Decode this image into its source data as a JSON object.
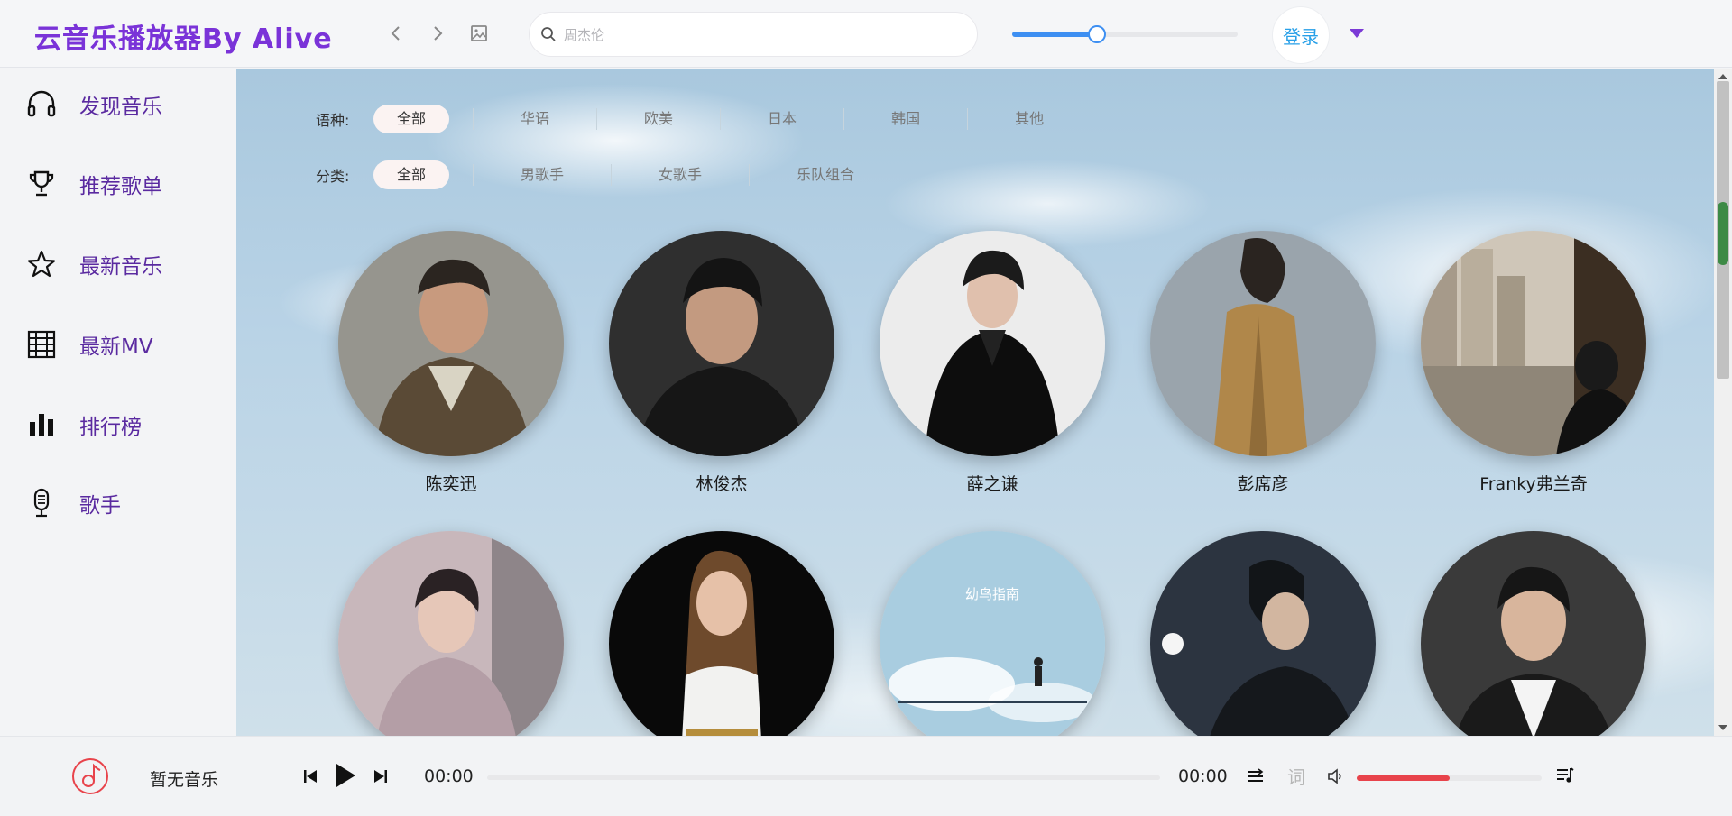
{
  "app": {
    "title": "云音乐播放器By Alive"
  },
  "header": {
    "search": {
      "placeholder": "周杰伦",
      "value": ""
    },
    "volume_level": 0.37,
    "login_label": "登录"
  },
  "sidebar": {
    "items": [
      {
        "label": "发现音乐",
        "icon": "headphones-icon"
      },
      {
        "label": "推荐歌单",
        "icon": "trophy-icon"
      },
      {
        "label": "最新音乐",
        "icon": "star-icon"
      },
      {
        "label": "最新MV",
        "icon": "film-icon"
      },
      {
        "label": "排行榜",
        "icon": "bar-chart-icon"
      },
      {
        "label": "歌手",
        "icon": "microphone-icon"
      }
    ]
  },
  "filters": {
    "language": {
      "label": "语种:",
      "options": [
        "全部",
        "华语",
        "欧美",
        "日本",
        "韩国",
        "其他"
      ],
      "selected": "全部"
    },
    "category": {
      "label": "分类:",
      "options": [
        "全部",
        "男歌手",
        "女歌手",
        "乐队组合"
      ],
      "selected": "全部"
    }
  },
  "artists": [
    {
      "name": "陈奕迅"
    },
    {
      "name": "林俊杰"
    },
    {
      "name": "薛之谦"
    },
    {
      "name": "彭席彦"
    },
    {
      "name": "Franky弗兰奇"
    },
    {
      "name": ""
    },
    {
      "name": ""
    },
    {
      "name": ""
    },
    {
      "name": ""
    },
    {
      "name": ""
    }
  ],
  "artist_cover_text": "幼鸟指南",
  "player": {
    "track_title": "暂无音乐",
    "current_time": "00:00",
    "total_time": "00:00",
    "progress": 0,
    "volume_level": 0.5,
    "lyrics_label": "词",
    "accent_color": "#e8434b"
  }
}
